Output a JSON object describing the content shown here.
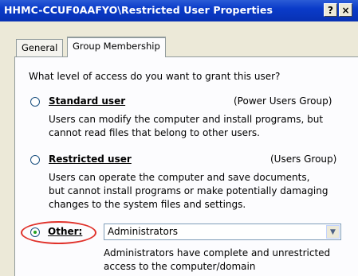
{
  "window": {
    "title": "HHMC-CCUF0AAFYO\\Restricted User Properties",
    "help_button": "?",
    "close_button": "×"
  },
  "tabs": [
    {
      "label": "General",
      "active": false
    },
    {
      "label": "Group Membership",
      "active": true
    }
  ],
  "question": "What level of access do you want to grant this user?",
  "options": {
    "standard": {
      "label": "Standard user",
      "group": "(Power Users Group)",
      "desc1": "Users can modify the computer and install programs, but",
      "desc2": "cannot read files that belong to other users.",
      "selected": false
    },
    "restricted": {
      "label": "Restricted user",
      "group": "(Users Group)",
      "desc1": "Users can operate the computer and save documents,",
      "desc2": "but cannot install programs or make potentially damaging",
      "desc3": "changes to the system files and settings.",
      "selected": false
    },
    "other": {
      "label": "Other:",
      "selected": true,
      "dropdown_value": "Administrators",
      "desc1": "Administrators have complete and unrestricted",
      "desc2": "access to the computer/domain"
    }
  },
  "colors": {
    "highlight": "#e0322b",
    "titlebar": "#0a3bc9"
  }
}
